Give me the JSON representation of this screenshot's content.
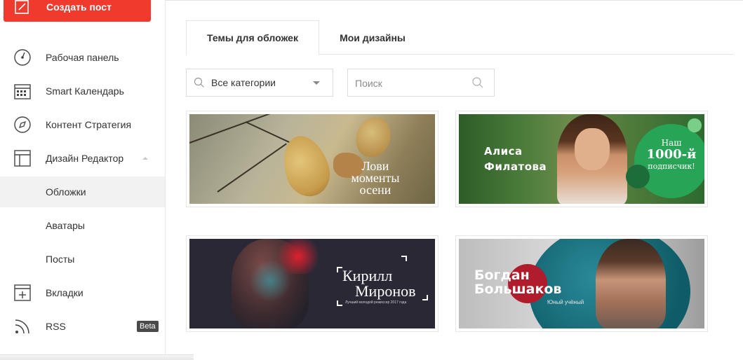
{
  "sidebar": {
    "create_button": "Создать пост",
    "items": [
      {
        "label": "Рабочая панель",
        "icon": "dashboard-gauge-icon"
      },
      {
        "label": "Smart Календарь",
        "icon": "calendar-icon"
      },
      {
        "label": "Контент Стратегия",
        "icon": "compass-icon"
      },
      {
        "label": "Дизайн Редактор",
        "icon": "layout-icon"
      },
      {
        "label": "Обложки",
        "icon": ""
      },
      {
        "label": "Аватары",
        "icon": ""
      },
      {
        "label": "Посты",
        "icon": ""
      },
      {
        "label": "Вкладки",
        "icon": "tab-add-icon"
      },
      {
        "label": "RSS",
        "icon": "rss-icon",
        "badge": "Beta"
      }
    ],
    "active_item": "Обложки"
  },
  "tabs": [
    {
      "label": "Темы для обложек",
      "active": true
    },
    {
      "label": "Мои дизайны",
      "active": false
    }
  ],
  "filters": {
    "category_selected": "Все категории",
    "search_placeholder": "Поиск",
    "search_value": ""
  },
  "covers": [
    {
      "text_lines": [
        "Лови",
        "моменты",
        "осени"
      ]
    },
    {
      "name_lines": [
        "Алиса",
        "Филатова"
      ],
      "badge_lines": [
        "Наш",
        "1000-й",
        "подписчик!"
      ]
    },
    {
      "name_lines": [
        "Кирилл",
        "Миронов"
      ],
      "caption": "Лучший молодой режиссер 2017 года"
    },
    {
      "name_lines": [
        "Богдан",
        "Большаков"
      ],
      "caption": "Юный учёный"
    }
  ],
  "colors": {
    "accent": "#f03a2e",
    "active_bg": "#f2f2f2",
    "badge_bg": "#4a4a4a"
  }
}
